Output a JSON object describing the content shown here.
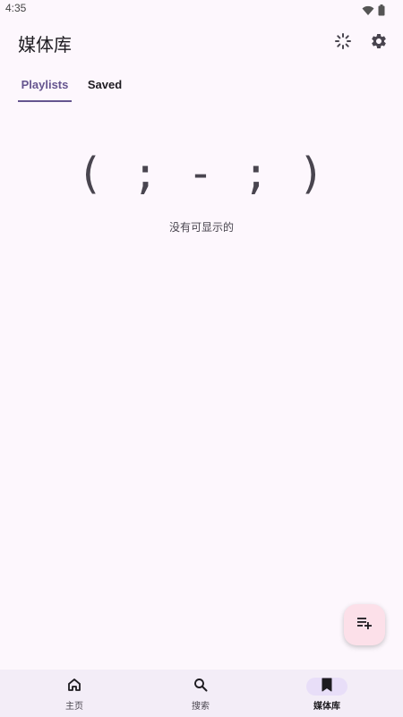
{
  "status_bar": {
    "time": "4:35",
    "icons": [
      "wifi-icon",
      "battery-icon"
    ]
  },
  "header": {
    "title": "媒体库",
    "actions": [
      "sync-icon",
      "settings-icon"
    ]
  },
  "tabs": [
    {
      "label": "Playlists",
      "selected": true
    },
    {
      "label": "Saved",
      "selected": false
    }
  ],
  "empty_state": {
    "face": "( ; - ; )",
    "message": "没有可显示的"
  },
  "fab": {
    "icon": "playlist-add-icon"
  },
  "bottom_nav": [
    {
      "label": "主页",
      "icon": "home-icon",
      "active": false
    },
    {
      "label": "搜索",
      "icon": "search-icon",
      "active": false
    },
    {
      "label": "媒体库",
      "icon": "library-icon",
      "active": true
    }
  ],
  "colors": {
    "background": "#fdf7fd",
    "accent": "#65558f",
    "fab_background": "#fce0e9",
    "nav_background": "#f3edf7",
    "nav_active_pill": "#e8def8"
  }
}
